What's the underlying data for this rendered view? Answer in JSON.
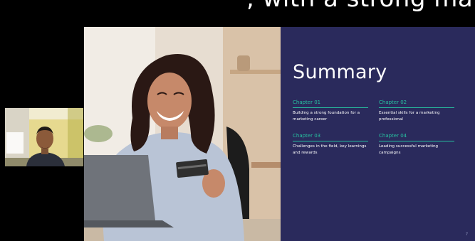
{
  "caption": {
    "text": ", with a strong marketing"
  },
  "slide": {
    "title": "Summary",
    "chapters": [
      {
        "label": "Chapter 01",
        "text": "Building a strong foundation for a marketing career"
      },
      {
        "label": "Chapter 02",
        "text": "Essential skills for a marketing professional"
      },
      {
        "label": "Chapter 03",
        "text": "Challenges in the field, key learnings and rewards"
      },
      {
        "label": "Chapter 04",
        "text": "Leading successful marketing campaigns"
      }
    ],
    "page_number": "7"
  },
  "colors": {
    "panel_bg": "#2a2a5c",
    "accent": "#27c1a0",
    "title": "#ffffff"
  }
}
